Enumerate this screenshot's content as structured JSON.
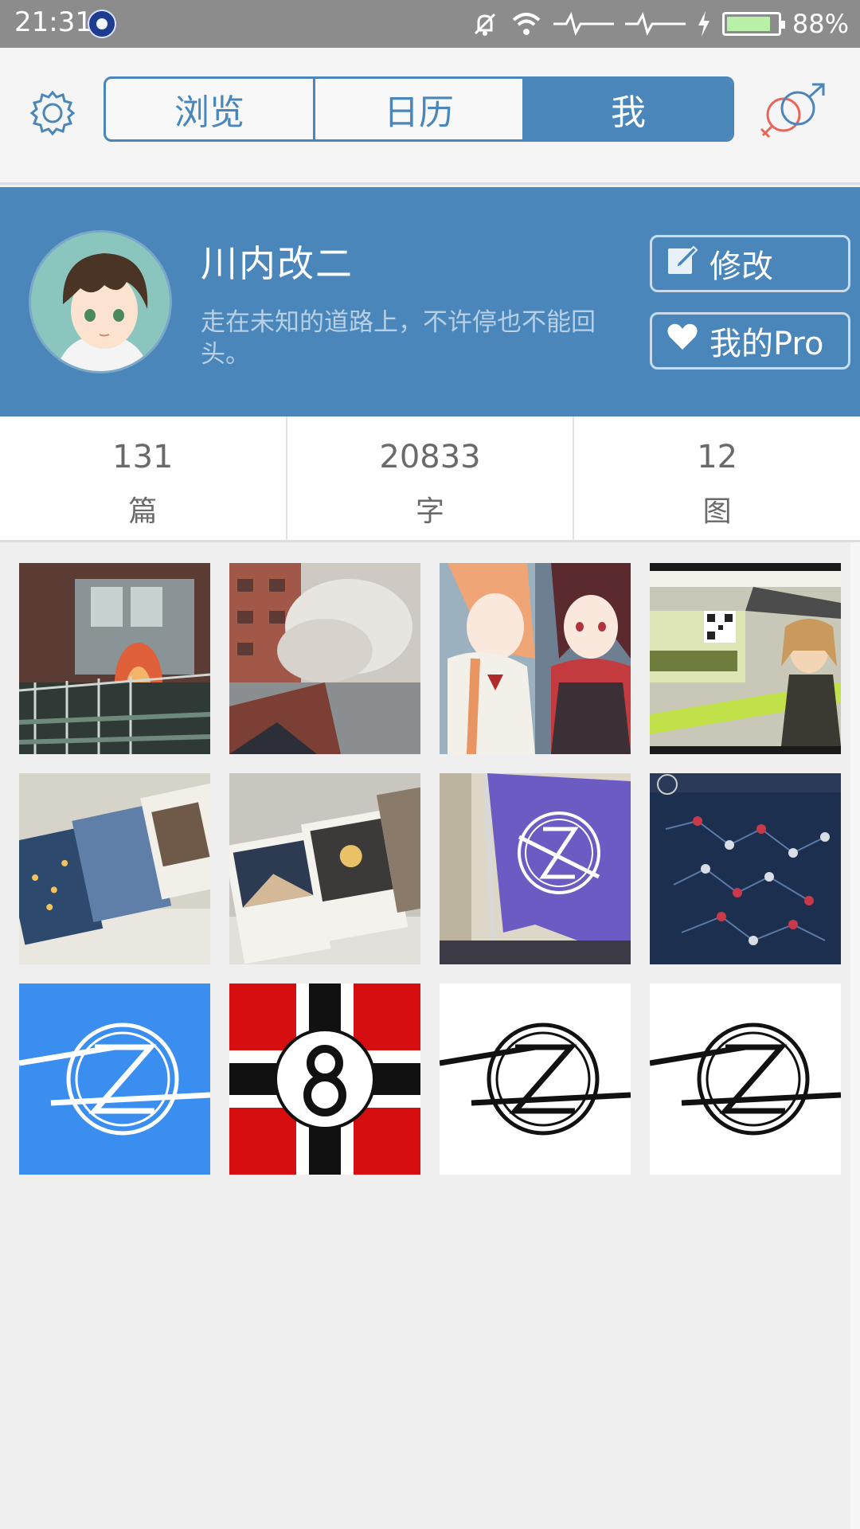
{
  "status_bar": {
    "time": "21:31",
    "battery_percent": "88%",
    "battery_level": 0.88,
    "icons": [
      "app-icon",
      "silent-icon",
      "wifi-icon",
      "signal-icon",
      "signal-icon",
      "charging-icon",
      "battery-icon"
    ]
  },
  "header": {
    "settings_icon": "gear-icon",
    "tabs": [
      {
        "label": "浏览",
        "active": false
      },
      {
        "label": "日历",
        "active": false
      },
      {
        "label": "我",
        "active": true
      }
    ],
    "gender_icon": "gender-icon"
  },
  "profile": {
    "name": "川内改二",
    "bio": "走在未知的道路上，不许停也不能回头。",
    "edit_label": "修改",
    "pro_label": "我的Pro",
    "edit_icon": "edit-icon",
    "pro_icon": "heart-icon"
  },
  "stats": [
    {
      "value": "131",
      "label": "篇"
    },
    {
      "value": "20833",
      "label": "字"
    },
    {
      "value": "12",
      "label": "图"
    }
  ],
  "colors": {
    "accent": "#4a86b9",
    "status_bar": "#8c8c8c",
    "background": "#efefef"
  },
  "gallery": [
    {
      "name": "fire-photo-1"
    },
    {
      "name": "smoke-photo"
    },
    {
      "name": "anime-girls-illustration"
    },
    {
      "name": "game-banner-screenshot"
    },
    {
      "name": "postcards-photo-1"
    },
    {
      "name": "postcards-photo-2"
    },
    {
      "name": "purple-flag-photo"
    },
    {
      "name": "game-map-screenshot"
    },
    {
      "name": "logo-blue"
    },
    {
      "name": "flag-8-red"
    },
    {
      "name": "logo-white-1"
    },
    {
      "name": "logo-white-2"
    }
  ]
}
